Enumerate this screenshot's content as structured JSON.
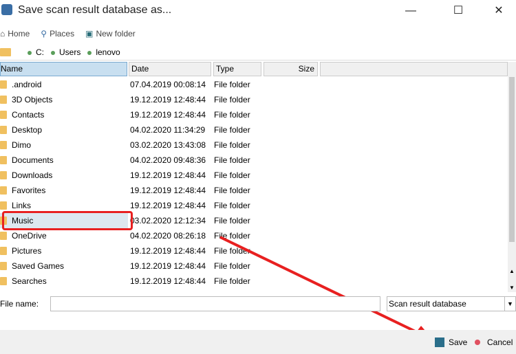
{
  "window": {
    "title": "Save scan result database as..."
  },
  "toolbar": {
    "home": "Home",
    "places": "Places",
    "new_folder": "New folder"
  },
  "breadcrumb": [
    "C:",
    "Users",
    "lenovo"
  ],
  "columns": {
    "name": "Name",
    "date": "Date",
    "type": "Type",
    "size": "Size"
  },
  "files": [
    {
      "name": ".android",
      "date": "07.04.2019 00:08:14",
      "type": "File folder"
    },
    {
      "name": "3D Objects",
      "date": "19.12.2019 12:48:44",
      "type": "File folder"
    },
    {
      "name": "Contacts",
      "date": "19.12.2019 12:48:44",
      "type": "File folder"
    },
    {
      "name": "Desktop",
      "date": "04.02.2020 11:34:29",
      "type": "File folder"
    },
    {
      "name": "Dimo",
      "date": "03.02.2020 13:43:08",
      "type": "File folder"
    },
    {
      "name": "Documents",
      "date": "04.02.2020 09:48:36",
      "type": "File folder"
    },
    {
      "name": "Downloads",
      "date": "19.12.2019 12:48:44",
      "type": "File folder"
    },
    {
      "name": "Favorites",
      "date": "19.12.2019 12:48:44",
      "type": "File folder"
    },
    {
      "name": "Links",
      "date": "19.12.2019 12:48:44",
      "type": "File folder"
    },
    {
      "name": "Music",
      "date": "03.02.2020 12:12:34",
      "type": "File folder"
    },
    {
      "name": "OneDrive",
      "date": "04.02.2020 08:26:18",
      "type": "File folder"
    },
    {
      "name": "Pictures",
      "date": "19.12.2019 12:48:44",
      "type": "File folder"
    },
    {
      "name": "Saved Games",
      "date": "19.12.2019 12:48:44",
      "type": "File folder"
    },
    {
      "name": "Searches",
      "date": "19.12.2019 12:48:44",
      "type": "File folder"
    }
  ],
  "selected_index": 9,
  "file_name": {
    "label": "File name:",
    "value": ""
  },
  "file_type": {
    "value": "Scan result database"
  },
  "buttons": {
    "save": "Save",
    "cancel": "Cancel"
  }
}
